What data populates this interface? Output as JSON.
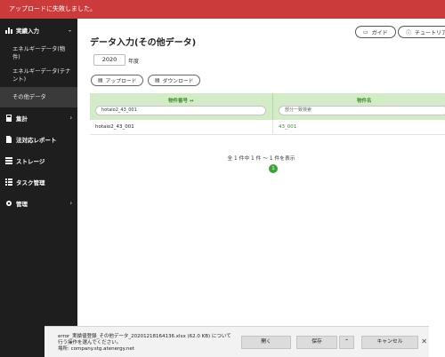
{
  "alert": {
    "message": "アップロードに失敗しました。"
  },
  "sidebar": {
    "section_title": "実績入力",
    "section_icon": "bar-chart-icon",
    "sub_items": [
      {
        "label": "エネルギーデータ(物件)",
        "active": false
      },
      {
        "label": "エネルギーデータ(テナント)",
        "active": false
      },
      {
        "label": "その他データ",
        "active": true
      }
    ],
    "items": [
      {
        "label": "集計",
        "icon": "calculator-icon",
        "has_arrow": true
      },
      {
        "label": "法対応レポート",
        "icon": "document-icon",
        "has_arrow": false
      },
      {
        "label": "ストレージ",
        "icon": "storage-icon",
        "has_arrow": false
      },
      {
        "label": "タスク管理",
        "icon": "task-list-icon",
        "has_arrow": false
      },
      {
        "label": "管理",
        "icon": "gear-icon",
        "has_arrow": true
      }
    ]
  },
  "main": {
    "title": "データ入力(その他データ)",
    "guide_label": "ガイド",
    "tutorial_label": "チュートリアル",
    "year_value": "2020",
    "year_suffix": "年度",
    "upload_label": "アップロード",
    "download_label": "ダウンロード",
    "table": {
      "columns": [
        {
          "label": "物件番号 ↔",
          "filter_value": "hotaio2_43_001"
        },
        {
          "label": "物件名",
          "filter_value": "部分一致検索"
        }
      ],
      "rows": [
        [
          "hotaio2_43_001",
          "43_001"
        ]
      ]
    },
    "pagination": {
      "info": "全 1 件中 1 件 〜 1 件を表示",
      "current_page": "1"
    }
  },
  "download_bar": {
    "filename_line": "error_実績値登録_その他データ_20201218164136.xlsx (62.0 KB) について",
    "prompt_line": "行う操作を選んでください。",
    "location_line": "場所: company.stg.atenergy.net",
    "open_label": "開く",
    "save_label": "保存",
    "cancel_label": "キャンセル"
  }
}
